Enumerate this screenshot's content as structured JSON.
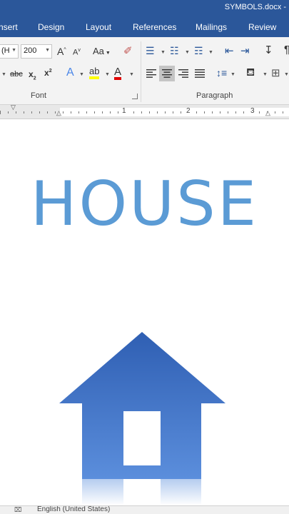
{
  "window": {
    "title": "SYMBOLS.docx -"
  },
  "tabs": [
    "nsert",
    "Design",
    "Layout",
    "References",
    "Mailings",
    "Review"
  ],
  "ribbon": {
    "font_name": "(H",
    "font_size": "200",
    "change_case": "Aa",
    "groups": {
      "font": "Font",
      "paragraph": "Paragraph"
    }
  },
  "ruler": {
    "numbers": [
      "1",
      "2",
      "3"
    ]
  },
  "document": {
    "heading": "HOUSE",
    "heading_color": "#5b9bd5",
    "house_color": "#3d73c6"
  },
  "status": {
    "language": "English (United States)"
  }
}
